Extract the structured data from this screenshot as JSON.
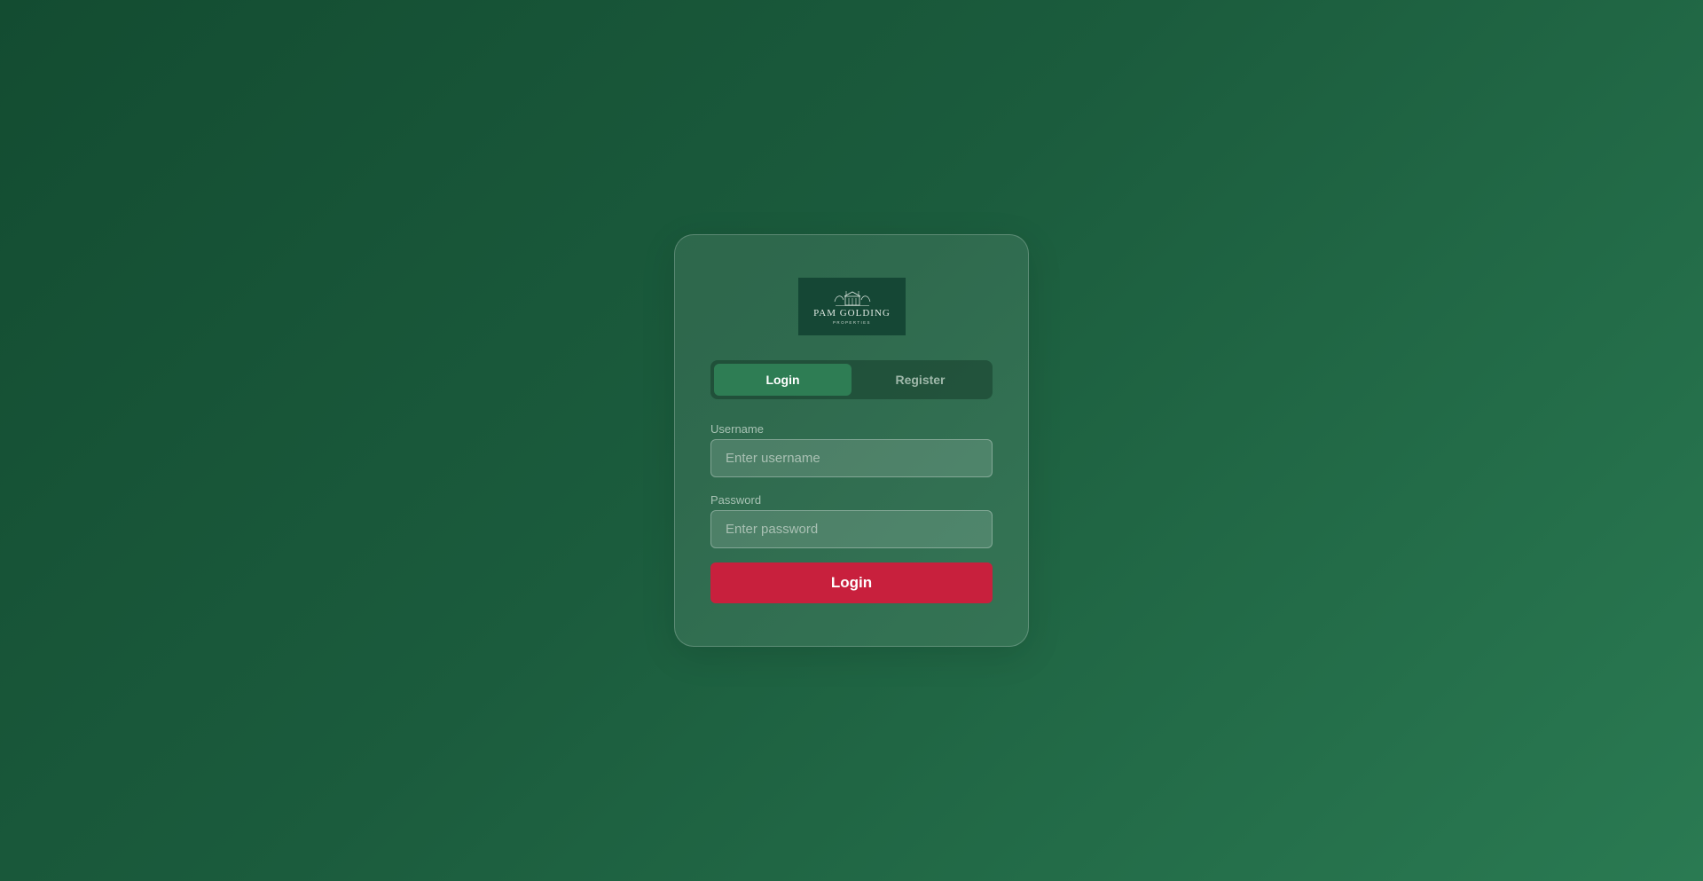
{
  "brand": {
    "name": "PAM GOLDING",
    "tagline": "PROPERTIES"
  },
  "tabs": [
    {
      "label": "Login",
      "active": true
    },
    {
      "label": "Register",
      "active": false
    }
  ],
  "form": {
    "username_label": "Username",
    "username_placeholder": "Enter username",
    "username_value": "",
    "password_label": "Password",
    "password_placeholder": "Enter password",
    "password_value": "",
    "submit_label": "Login"
  },
  "colors": {
    "background_start": "#134c31",
    "background_end": "#2a7a52",
    "tab_active": "#2e7d54",
    "submit_button": "#c8203d",
    "logo_background": "#154735"
  }
}
